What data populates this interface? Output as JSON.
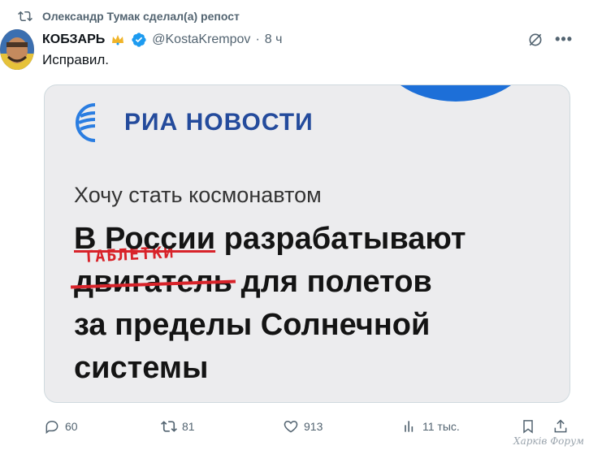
{
  "repost": {
    "text": "Олександр Тумак сделал(а) репост",
    "icon": "repost-icon"
  },
  "tweet": {
    "author_name": "КОБЗАРЬ",
    "handle": "@KostaKrempov",
    "separator": "·",
    "time": "8 ч",
    "text": "Исправил."
  },
  "media": {
    "logo_text": "РИА НОВОСТИ",
    "kicker": "Хочу стать космонавтом",
    "headline_line1_a": "В России",
    "headline_line1_b": " разрабатывают",
    "handwritten": "ТАБЛЕТКИ",
    "struck_word": "двигатель",
    "headline_line2_rest": " для полетов",
    "headline_line3": "за пределы Солнечной",
    "headline_line4": "системы"
  },
  "actions": {
    "replies": "60",
    "reposts": "81",
    "likes": "913",
    "views": "11 тыс."
  },
  "watermark": "Харків Форум",
  "colors": {
    "accent": "#1d9bf0",
    "muted": "#536471",
    "ria_blue": "#244b9c",
    "red": "#d8232a"
  }
}
